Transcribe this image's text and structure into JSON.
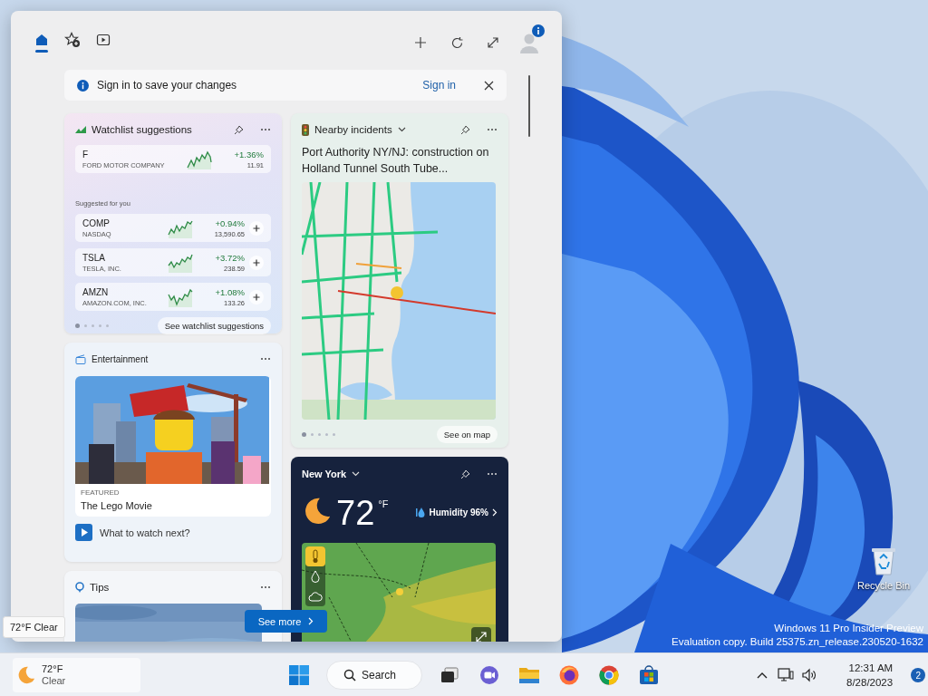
{
  "panel": {
    "tabs": [
      {
        "kind": "home",
        "selected": true
      },
      {
        "kind": "favorites",
        "selected": false
      },
      {
        "kind": "video",
        "selected": false
      }
    ],
    "notice": {
      "text": "Sign in to save your changes",
      "link": "Sign in"
    },
    "watchlist": {
      "title": "Watchlist suggestions",
      "featured": {
        "symbol": "F",
        "name": "FORD MOTOR COMPANY",
        "change": "+1.36%",
        "price": "11.91"
      },
      "subheading": "Suggested for you",
      "stocks": [
        {
          "symbol": "COMP",
          "name": "NASDAQ",
          "change": "+0.94%",
          "price": "13,590.65"
        },
        {
          "symbol": "TSLA",
          "name": "TESLA, INC.",
          "change": "+3.72%",
          "price": "238.59"
        },
        {
          "symbol": "AMZN",
          "name": "AMAZON.COM, INC.",
          "change": "+1.08%",
          "price": "133.26"
        }
      ],
      "pager": [
        {
          "selected": true
        },
        {
          "selected": false
        },
        {
          "selected": false
        },
        {
          "selected": false
        },
        {
          "selected": false
        }
      ],
      "link": "See watchlist suggestions"
    },
    "entertainment": {
      "title": "Entertainment",
      "tag": "FEATURED",
      "movie": "The Lego Movie",
      "footer": "What to watch next?"
    },
    "tips": {
      "title": "Tips"
    },
    "incidents": {
      "title": "Nearby incidents",
      "headline": "Port Authority NY/NJ: construction on Holland Tunnel South Tube...",
      "pager": [
        {
          "selected": true
        },
        {
          "selected": false
        },
        {
          "selected": false
        },
        {
          "selected": false
        },
        {
          "selected": false
        }
      ],
      "link": "See on map"
    },
    "weather": {
      "city": "New York",
      "temperature": "72",
      "unit": "°F",
      "humidity": "Humidity 96%",
      "layers": [
        {
          "kind": "temperature",
          "selected": true
        },
        {
          "kind": "precipitation",
          "selected": false
        },
        {
          "kind": "clouds",
          "selected": false
        }
      ]
    },
    "see_more": "See more"
  },
  "desktop": {
    "icons": [
      {
        "label": "Recycle Bin"
      }
    ],
    "tooltip": "72°F Clear",
    "watermark": [
      "Windows 11 Pro Insider Preview",
      "Evaluation copy. Build 25375.zn_release.230520-1632"
    ]
  },
  "taskbar": {
    "weather": {
      "temperature": "72°F",
      "condition": "Clear"
    },
    "apps": [
      {
        "kind": "start"
      },
      {
        "kind": "search",
        "label": "Search"
      },
      {
        "kind": "taskview"
      },
      {
        "kind": "chat"
      },
      {
        "kind": "explorer"
      },
      {
        "kind": "firefox"
      },
      {
        "kind": "chrome"
      },
      {
        "kind": "store"
      }
    ],
    "tray": [
      {
        "kind": "chevron"
      },
      {
        "kind": "network"
      },
      {
        "kind": "volume"
      }
    ],
    "clock": {
      "time": "12:31 AM",
      "date": "8/28/2023"
    },
    "notifications": "2"
  }
}
